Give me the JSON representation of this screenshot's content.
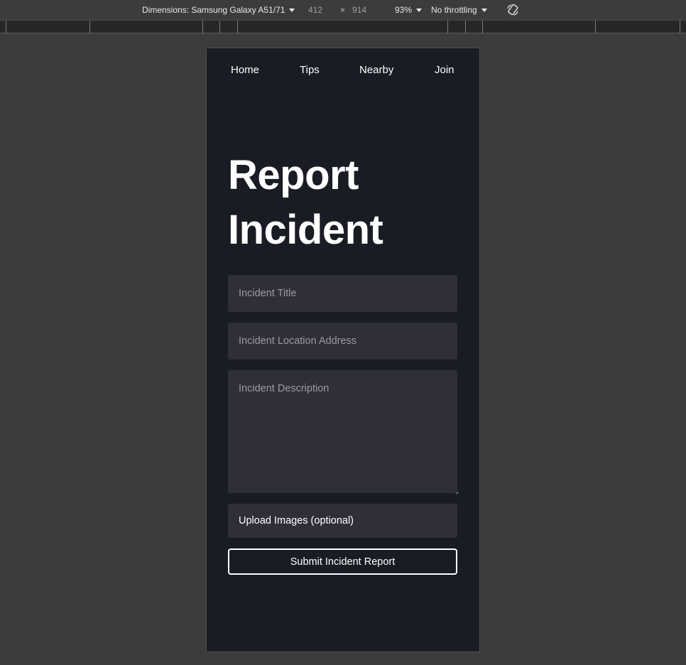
{
  "devtools": {
    "dimensions_label": "Dimensions: Samsung Galaxy A51/71",
    "width": "412",
    "times": "×",
    "height": "914",
    "zoom": "93%",
    "throttling": "No throttling",
    "rotate_icon": "rotate-icon"
  },
  "nav": {
    "items": [
      {
        "label": "Home"
      },
      {
        "label": "Tips"
      },
      {
        "label": "Nearby"
      },
      {
        "label": "Join"
      }
    ]
  },
  "page": {
    "title_line1": "Report",
    "title_line2": "Incident"
  },
  "form": {
    "title_placeholder": "Incident Title",
    "title_value": "",
    "address_placeholder": "Incident Location Address",
    "address_value": "",
    "description_placeholder": "Incident Description",
    "description_value": "",
    "upload_label": "Upload Images (optional)",
    "submit_label": "Submit Incident Report"
  },
  "colors": {
    "page_bg": "#1a1c24",
    "field_bg": "#2f2f3a",
    "text": "#ffffff",
    "placeholder": "#9a9aa4",
    "devtools_bg": "#3c3c3c"
  }
}
